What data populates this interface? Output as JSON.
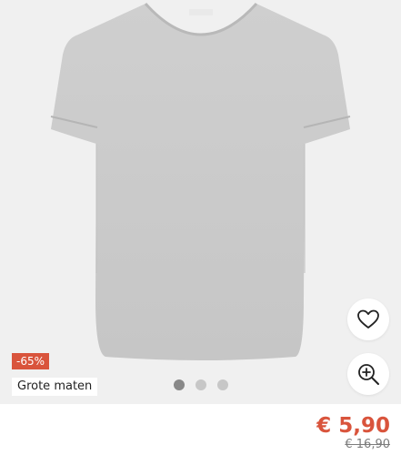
{
  "product": {
    "discount_badge": "-65%",
    "tag_label": "Grote maten",
    "price_current": "€ 5,90",
    "price_old": "€ 16,90"
  },
  "gallery": {
    "dot_count": 3,
    "active_index": 0
  },
  "icons": {
    "wishlist": "heart-icon",
    "zoom": "zoom-in-icon"
  },
  "colors": {
    "accent": "#d9543c",
    "image_background": "#f0f0f0",
    "dot_active": "#888888",
    "dot_inactive": "#c7c7c7"
  }
}
